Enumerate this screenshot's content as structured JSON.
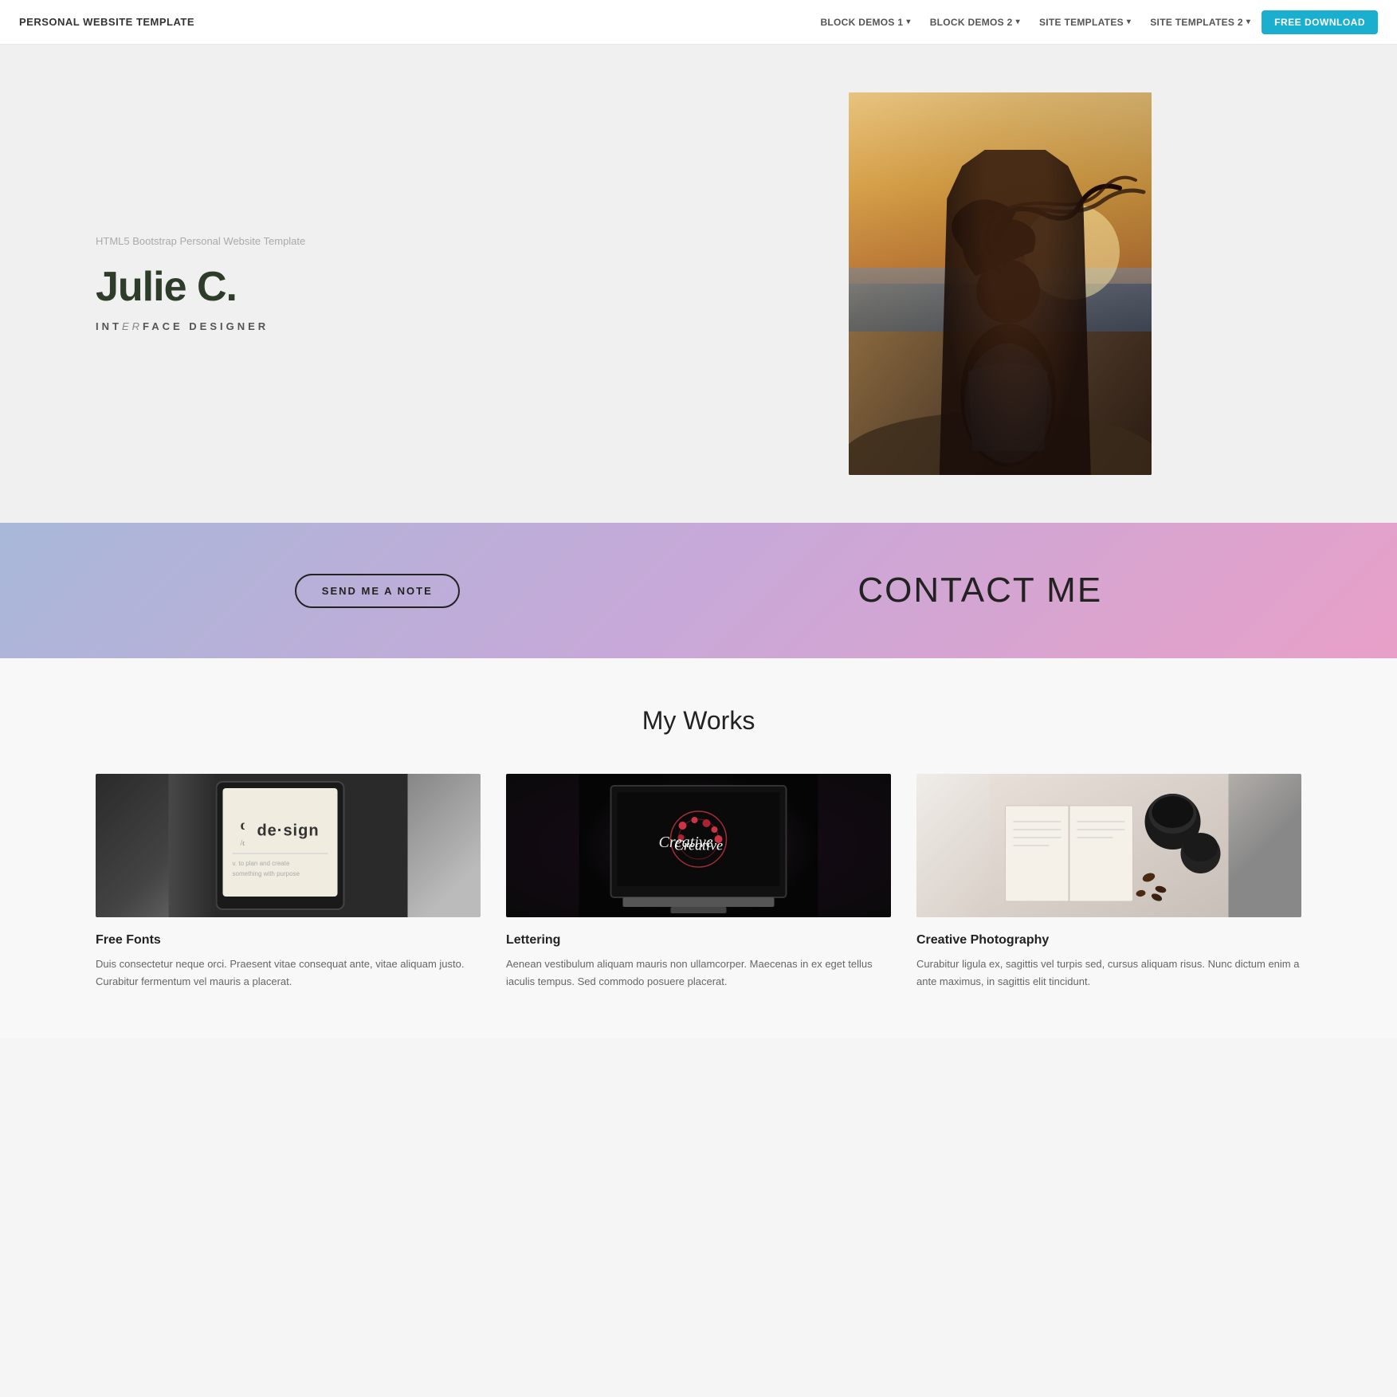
{
  "navbar": {
    "brand": "PERSONAL WEBSITE TEMPLATE",
    "links": [
      {
        "label": "BLOCK DEMOS 1",
        "has_caret": true
      },
      {
        "label": "BLOCK DEMOS 2",
        "has_caret": true
      },
      {
        "label": "SITE TEMPLATES",
        "has_caret": true
      },
      {
        "label": "SITE TEMPLATES 2",
        "has_caret": true
      }
    ],
    "cta_label": "FREE DOWNLOAD"
  },
  "hero": {
    "subtitle": "HTML5 Bootstrap Personal Website Template",
    "name": "Julie C.",
    "role_prefix": "INT",
    "role_italic": "ER",
    "role_suffix": "FACE DESIGNER"
  },
  "contact": {
    "button_label": "SEND ME A NOTE",
    "title": "CONTACT ME"
  },
  "works": {
    "section_title": "My Works",
    "items": [
      {
        "title": "Free Fonts",
        "description": "Duis consectetur neque orci. Praesent vitae consequat ante, vitae aliquam justo. Curabitur fermentum vel mauris a placerat."
      },
      {
        "title": "Lettering",
        "description": "Aenean vestibulum aliquam mauris non ullamcorper. Maecenas in ex eget tellus iaculis tempus. Sed commodo posuere placerat."
      },
      {
        "title": "Creative Photography",
        "description": "Curabitur ligula ex, sagittis vel turpis sed, cursus aliquam risus. Nunc dictum enim a ante maximus, in sagittis elit tincidunt."
      }
    ]
  }
}
